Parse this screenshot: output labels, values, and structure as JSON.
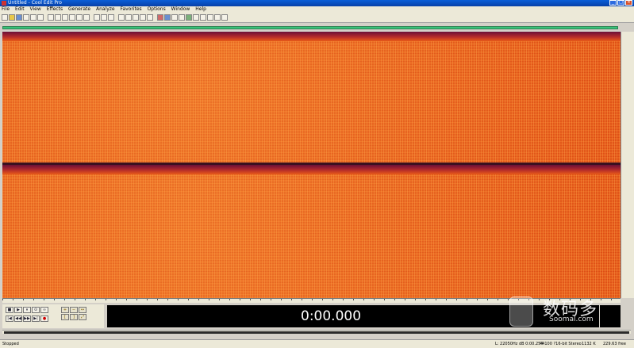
{
  "window": {
    "title": "Untitled - Cool Edit Pro"
  },
  "menu": [
    "File",
    "Edit",
    "View",
    "Effects",
    "Generate",
    "Analyze",
    "Favorites",
    "Options",
    "Window",
    "Help"
  ],
  "transport": {
    "buttons_top": [
      "■",
      "▶",
      "⏸",
      "⊙",
      "∞"
    ],
    "buttons_bottom": [
      "|◀",
      "◀◀",
      "▶▶",
      "▶|",
      "●"
    ]
  },
  "time_display": "0:00.000",
  "status": {
    "left": "Stopped",
    "pos": "L: 22050Hz dB   0:00.254",
    "format": "44100 ?16-bit Stereo",
    "size": "1132 K",
    "free": "229.63 free"
  },
  "watermark": {
    "cn": "数码多",
    "en": "Soomal.com"
  },
  "colors": {
    "spectral": "#e85a18",
    "overview": "#39c27a",
    "titlebar": "#0a5fd8",
    "display_bg": "#000000"
  }
}
